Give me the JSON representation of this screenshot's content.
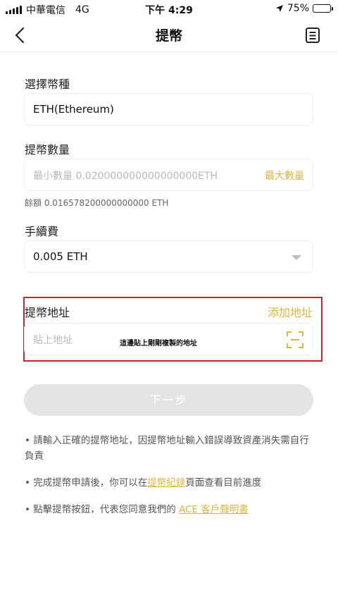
{
  "status_bar": {
    "carrier": "中華電信",
    "network": "4G",
    "time": "下午 4:29",
    "battery": "75%",
    "battery_level": 0.75
  },
  "nav": {
    "title": "提幣",
    "back_icon": "chevron-left-icon",
    "record_icon": "document-list-icon"
  },
  "form": {
    "currency": {
      "label": "選擇幣種",
      "value": "ETH(Ethereum)"
    },
    "amount": {
      "label": "提幣數量",
      "placeholder": "最小數量 0.020000000000000000ETH",
      "max_label": "最大數量",
      "balance": "餘額 0.016578200000000000 ETH"
    },
    "fee": {
      "label": "手續費",
      "value": "0.005 ETH",
      "dropdown_icon": "caret-down-icon"
    },
    "address": {
      "label": "提幣地址",
      "add_label": "添加地址",
      "placeholder": "貼上地址",
      "annotation": "這邊貼上剛剛複製的地址",
      "scan_icon": "scan-icon",
      "highlight_color": "#c3282d"
    },
    "next_label": "下一步"
  },
  "tips": {
    "tip1": "請輸入正確的提幣地址，因提幣地址輸入錯誤導致資產消失需自行負責",
    "tip2_before": "完成提幣申請後，你可以在",
    "tip2_link": "提幣紀錄",
    "tip2_after": "頁面查看目前進度",
    "tip3_before": "點擊提幣按鈕，代表您同意我們的 ",
    "tip3_link": "ACE 客戶聲明書",
    "bullet": "•"
  },
  "colors": {
    "accent": "#d9b63c",
    "disabled_button": "#e4e4e4",
    "annotation_border": "#c3282d"
  }
}
